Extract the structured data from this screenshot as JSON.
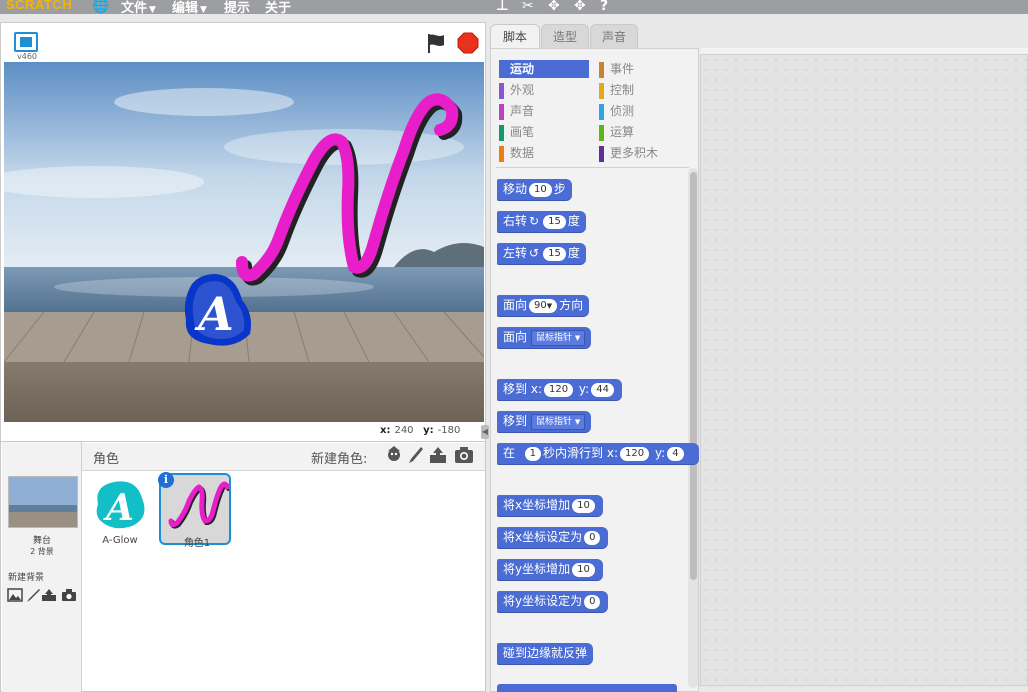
{
  "menu": {
    "logo": "SCRATCH",
    "file": "文件",
    "edit": "编辑",
    "tips": "提示",
    "about": "关于"
  },
  "stage": {
    "version": "v460",
    "x_label": "x:",
    "x_value": "240",
    "y_label": "y:",
    "y_value": "-180"
  },
  "sprites": {
    "header_label": "角色",
    "new_sprite_label": "新建角色:",
    "stage_name": "舞台",
    "stage_backdrops": "2 背景",
    "new_backdrop_label": "新建背景",
    "items": [
      {
        "name": "A-Glow"
      },
      {
        "name": "角色1"
      }
    ]
  },
  "tabs": {
    "scripts": "脚本",
    "costumes": "造型",
    "sounds": "声音"
  },
  "categories": [
    {
      "label": "运动",
      "color": "#4a6cd4",
      "selected": true
    },
    {
      "label": "事件",
      "color": "#c88330",
      "selected": false
    },
    {
      "label": "外观",
      "color": "#8a55d7",
      "selected": false
    },
    {
      "label": "控制",
      "color": "#e1a91a",
      "selected": false
    },
    {
      "label": "声音",
      "color": "#bb42c3",
      "selected": false
    },
    {
      "label": "侦测",
      "color": "#2ca5e2",
      "selected": false
    },
    {
      "label": "画笔",
      "color": "#0e9a6c",
      "selected": false
    },
    {
      "label": "运算",
      "color": "#5cb712",
      "selected": false
    },
    {
      "label": "数据",
      "color": "#ee7d16",
      "selected": false
    },
    {
      "label": "更多积木",
      "color": "#632d99",
      "selected": false
    }
  ],
  "blocks": {
    "move": {
      "pre": "移动",
      "val": "10",
      "post": "步"
    },
    "turn_right": {
      "pre": "右转",
      "val": "15",
      "post": "度"
    },
    "turn_left": {
      "pre": "左转",
      "val": "15",
      "post": "度"
    },
    "point_dir": {
      "pre": "面向",
      "val": "90",
      "post": "方向"
    },
    "point_towards": {
      "pre": "面向",
      "val": "鼠标指针"
    },
    "go_to_xy": {
      "pre": "移到",
      "x_label": "x:",
      "x": "120",
      "y_label": "y:",
      "y": "44"
    },
    "go_to": {
      "pre": "移到",
      "val": "鼠标指针"
    },
    "glide": {
      "pre": "在",
      "secs": "1",
      "mid": "秒内滑行到",
      "x_label": "x:",
      "x": "120",
      "y_label": "y:",
      "y": "4"
    },
    "change_x": {
      "pre": "将x坐标增加",
      "val": "10"
    },
    "set_x": {
      "pre": "将x坐标设定为",
      "val": "0"
    },
    "change_y": {
      "pre": "将y坐标增加",
      "val": "10"
    },
    "set_y": {
      "pre": "将y坐标设定为",
      "val": "0"
    },
    "bounce": {
      "pre": "碰到边缘就反弹"
    }
  },
  "colors": {
    "motion": "#4a6cd4",
    "selected_tile_border": "#1e8fd6",
    "pink_sprite": "#e81ecb",
    "blue_sprite": "#0a35c9",
    "glow_sprite": "#13bfc6"
  }
}
